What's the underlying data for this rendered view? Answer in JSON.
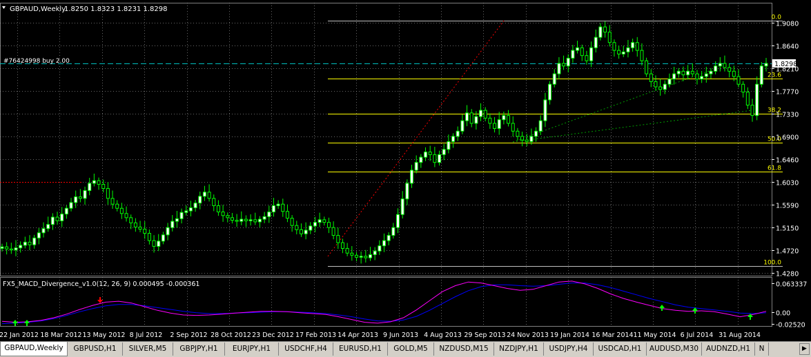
{
  "header": {
    "symbol_timeframe": "GBPAUD,Weekly",
    "ohlc": "1.8250 1.8323 1.8231 1.8298"
  },
  "trade_label": "#76424998 buy 2.00",
  "indicator_label": "FX5_MACD_Divergence_v1.0(12, 26, 9) 0.000495 -0.000361",
  "price_axis": {
    "ticks": [
      "1.9080",
      "1.8640",
      "1.8210",
      "1.7770",
      "1.7330",
      "1.6900",
      "1.6460",
      "1.6030",
      "1.5590",
      "1.5150",
      "1.4720",
      "1.4280"
    ],
    "current_price": "1.8298"
  },
  "macd_axis": {
    "ticks": [
      "0.063337",
      "0.00",
      "-0.02520"
    ]
  },
  "fib_levels": [
    {
      "label": "0.0",
      "price": 1.912
    },
    {
      "label": "23.6",
      "price": 1.8015
    },
    {
      "label": "38.2",
      "price": 1.733
    },
    {
      "label": "50.0",
      "price": 1.678
    },
    {
      "label": "61.8",
      "price": 1.6225
    },
    {
      "label": "100.0",
      "price": 1.4415
    }
  ],
  "date_axis": {
    "labels": [
      "22 Jan 2012",
      "18 Mar 2012",
      "13 May 2012",
      "8 Jul 2012",
      "2 Sep 2012",
      "28 Oct 2012",
      "23 Dec 2012",
      "17 Feb 2013",
      "14 Apr 2013",
      "9 Jun 2013",
      "4 Aug 2013",
      "29 Sep 2013",
      "24 Nov 2013",
      "19 Jan 2014",
      "16 Mar 2014",
      "11 May 2014",
      "6 Jul 2014",
      "31 Aug 2014"
    ]
  },
  "colors": {
    "bull_candle": "#ffffff",
    "bear_candle": "#000000",
    "candle_outline": "#00ff00",
    "fib_line": "#ffff00",
    "grid": "#c0c0c0",
    "trade_line": "#00c0c0",
    "macd_main": "#ff00ff",
    "macd_signal": "#0000ff",
    "trend_red": "#ff0000",
    "arrow_green": "#00ff00",
    "arrow_red": "#ff0000"
  },
  "tabs": [
    {
      "label": "GBPAUD,Weekly",
      "active": true
    },
    {
      "label": "GBPUSD,H1"
    },
    {
      "label": "SILVER,M5"
    },
    {
      "label": "GBPJPY,H1"
    },
    {
      "label": "EURJPY,H1"
    },
    {
      "label": "USDCHF,H4"
    },
    {
      "label": "EURUSD,H1"
    },
    {
      "label": "GOLD,M5"
    },
    {
      "label": "NZDUSD,M15"
    },
    {
      "label": "NZDJPY,H1"
    },
    {
      "label": "USDJPY,H4"
    },
    {
      "label": "USDCAD,H1"
    },
    {
      "label": "AUDUSD,M30"
    },
    {
      "label": "AUDNZD,H1"
    },
    {
      "label": "N"
    }
  ],
  "tab_scroll_icon": "chevron-right-icon"
}
